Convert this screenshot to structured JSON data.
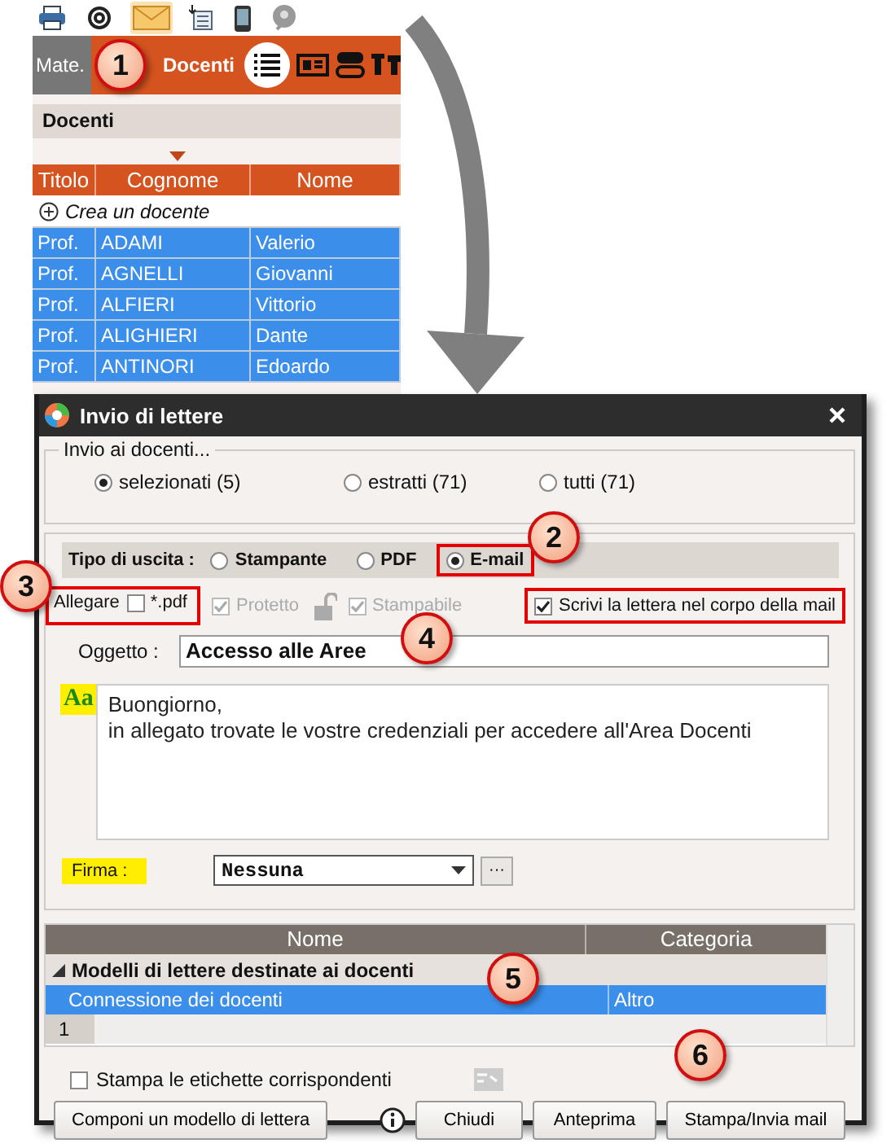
{
  "toolbar": [
    {
      "selected": false
    },
    {
      "selected": false
    },
    {
      "selected": true
    },
    {
      "selected": false
    },
    {
      "selected": false
    },
    {
      "selected": false
    }
  ],
  "tabs": [
    {
      "label": "Mate.",
      "selected": false
    },
    {
      "label": "Docenti",
      "selected": true
    }
  ],
  "views": [
    {
      "selected": true
    },
    {
      "selected": false
    },
    {
      "selected": false
    },
    {
      "selected": false
    }
  ],
  "panel_title": "Docenti",
  "table": {
    "columns": [
      "Titolo",
      "Cognome",
      "Nome"
    ],
    "create_label": "Crea un docente",
    "rows": [
      {
        "cells": [
          "Prof.",
          "ADAMI",
          "Valerio"
        ],
        "selected": true
      },
      {
        "cells": [
          "Prof.",
          "AGNELLI",
          "Giovanni"
        ],
        "selected": true
      },
      {
        "cells": [
          "Prof.",
          "ALFIERI",
          "Vittorio"
        ],
        "selected": true
      },
      {
        "cells": [
          "Prof.",
          "ALIGHIERI",
          "Dante"
        ],
        "selected": true
      },
      {
        "cells": [
          "Prof.",
          "ANTINORI",
          "Edoardo"
        ],
        "selected": true
      }
    ]
  },
  "dialog": {
    "title": "Invio di lettere",
    "recipients": {
      "legend": "Invio ai docenti...",
      "options": [
        {
          "label": "selezionati (5)",
          "selected": true
        },
        {
          "label": "estratti (71)",
          "selected": false
        },
        {
          "label": "tutti (71)",
          "selected": false
        }
      ]
    },
    "output": {
      "label": "Tipo di uscita :",
      "options": [
        {
          "label": "Stampante",
          "selected": false,
          "highlighted": false
        },
        {
          "label": "PDF",
          "selected": false,
          "highlighted": false
        },
        {
          "label": "E-mail",
          "selected": true,
          "highlighted": true
        }
      ]
    },
    "attach": {
      "label": "Allegare",
      "option": "*.pdf",
      "checked": false,
      "highlighted": true
    },
    "pdf_options": [
      {
        "label": "Protetto",
        "checked": true,
        "disabled": true
      },
      {
        "label": "Stampabile",
        "checked": true,
        "disabled": true
      }
    ],
    "body_in_mail": {
      "label": "Scrivi la lettera nel corpo della mail",
      "checked": true,
      "highlighted": true
    },
    "subject": {
      "label": "Oggetto :",
      "value": "Accesso alle Aree"
    },
    "format_icon": "Aa",
    "body": [
      "Buongiorno,",
      "in allegato trovate le vostre credenziali per accedere all'Area Docenti"
    ],
    "signature": {
      "label": "Firma :",
      "highlighted": true,
      "value": "Nessuna",
      "button": "···"
    },
    "templates": {
      "columns": [
        "Nome",
        "Categoria"
      ],
      "groups": [
        {
          "label": "Modelli di lettere destinate ai docenti",
          "expanded": true,
          "rows": [
            {
              "cells": [
                "Connessione dei docenti",
                "Altro"
              ],
              "selected": true
            }
          ]
        }
      ],
      "count": "1"
    },
    "labels_option": {
      "label": "Stampa le etichette corrispondenti",
      "checked": false
    },
    "compose_button": "Componi un modello di lettera",
    "buttons": [
      "Chiudi",
      "Anteprima",
      "Stampa/Invia mail"
    ]
  },
  "callouts": [
    "1",
    "2",
    "3",
    "4",
    "5",
    "6"
  ]
}
